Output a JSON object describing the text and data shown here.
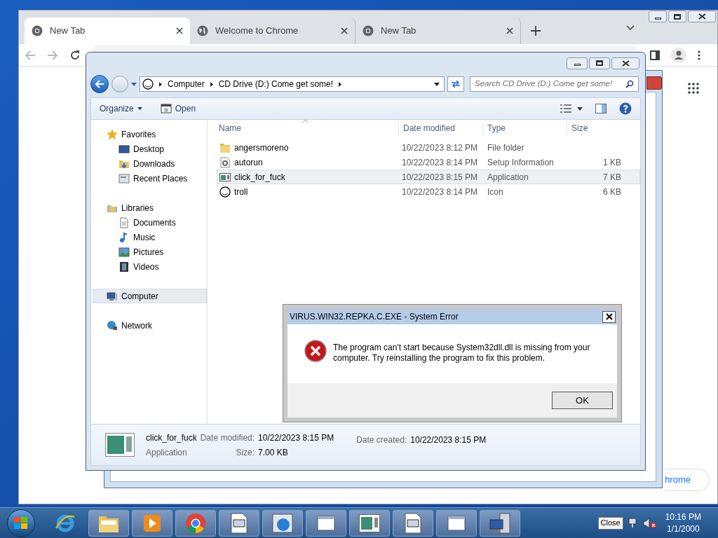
{
  "browser": {
    "tabs": [
      {
        "title": "New Tab",
        "selected": true
      },
      {
        "title": "Welcome to Chrome",
        "selected": false
      },
      {
        "title": "New Tab",
        "selected": false
      }
    ],
    "customize_button": "hrome"
  },
  "explorer": {
    "breadcrumb": [
      "Computer",
      "CD Drive (D:) Come get some!"
    ],
    "search_placeholder": "Search CD Drive (D:) Come get some!",
    "toolbar": [
      "Organize",
      "Open"
    ],
    "nav": [
      {
        "label": "Favorites",
        "selected": false,
        "children": [
          {
            "label": "Desktop",
            "selected": false
          },
          {
            "label": "Downloads",
            "selected": false
          },
          {
            "label": "Recent Places",
            "selected": false
          }
        ]
      },
      {
        "label": "Libraries",
        "selected": false,
        "children": [
          {
            "label": "Documents",
            "selected": false
          },
          {
            "label": "Music",
            "selected": false
          },
          {
            "label": "Pictures",
            "selected": false
          },
          {
            "label": "Videos",
            "selected": false
          }
        ]
      },
      {
        "label": "Computer",
        "selected": true
      },
      {
        "label": "Network",
        "selected": false
      }
    ],
    "columns": [
      "Name",
      "Date modified",
      "Type",
      "Size"
    ],
    "rows": [
      {
        "kind": "folder",
        "name": "angersmoreno",
        "date": "10/22/2023 8:12 PM",
        "type": "File folder",
        "size": "",
        "selected": false
      },
      {
        "kind": "settings",
        "name": "autorun",
        "date": "10/22/2023 8:14 PM",
        "type": "Setup Information",
        "size": "1 KB",
        "selected": false
      },
      {
        "kind": "application",
        "name": "click_for_fuck",
        "date": "10/22/2023 8:15 PM",
        "type": "Application",
        "size": "7 KB",
        "selected": true
      },
      {
        "kind": "icon",
        "name": "troll",
        "date": "10/22/2023 8:14 PM",
        "type": "Icon",
        "size": "6 KB",
        "selected": false
      }
    ],
    "details": {
      "name": "click_for_fuck",
      "type": "Application",
      "fields": [
        {
          "label": "Date modified:",
          "value": "10/22/2023 8:15 PM"
        },
        {
          "label": "Size:",
          "value": "7.00 KB"
        },
        {
          "label": "Date created:",
          "value": "10/22/2023 8:15 PM"
        }
      ]
    }
  },
  "dialog": {
    "title": "VIRUS.WIN32.REPKA.C.EXE - System Error",
    "message": "The program can't start because System32dll.dll is missing from your computer. Try reinstalling the program to fix this problem.",
    "button": "OK"
  },
  "taskbar": {
    "tooltip": "Close",
    "time": "10:16 PM",
    "date": "1/1/2000"
  }
}
